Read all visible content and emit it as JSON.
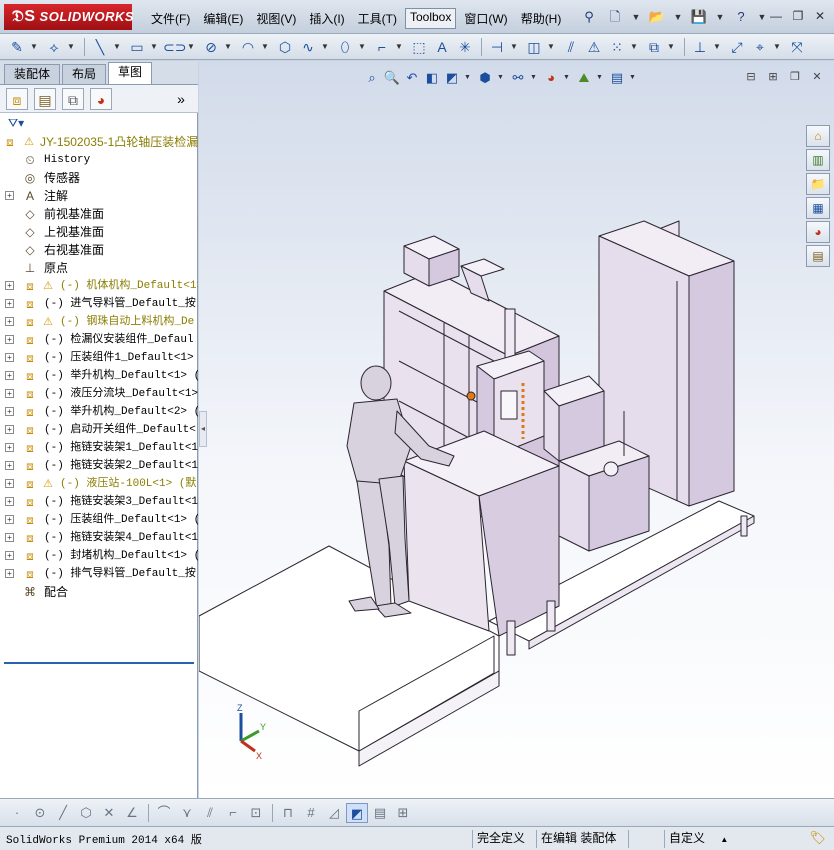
{
  "app": {
    "logo_ds": "𝔇S",
    "logo_text": "SOLIDWORKS"
  },
  "menu": [
    {
      "label": "文件(F)"
    },
    {
      "label": "编辑(E)"
    },
    {
      "label": "视图(V)"
    },
    {
      "label": "插入(I)"
    },
    {
      "label": "工具(T)"
    },
    {
      "label": "Toolbox"
    },
    {
      "label": "窗口(W)"
    },
    {
      "label": "帮助(H)"
    }
  ],
  "tabs": [
    {
      "label": "装配体"
    },
    {
      "label": "布局"
    },
    {
      "label": "草图"
    }
  ],
  "tree": {
    "root": "JY-1502035-1凸轮轴压装检漏",
    "items": [
      {
        "label": "History",
        "icon": "history-icon",
        "glyph": "⏲",
        "mono": true
      },
      {
        "label": "传感器",
        "icon": "sensor-icon",
        "glyph": "◎"
      },
      {
        "label": "注解",
        "icon": "annotation-icon",
        "glyph": "A"
      },
      {
        "label": "前视基准面",
        "icon": "plane-icon",
        "glyph": "◇"
      },
      {
        "label": "上视基准面",
        "icon": "plane-icon",
        "glyph": "◇"
      },
      {
        "label": "右视基准面",
        "icon": "plane-icon",
        "glyph": "◇"
      },
      {
        "label": "原点",
        "icon": "origin-icon",
        "glyph": "⊥"
      },
      {
        "label": "(-) 机体机构_Default<1>",
        "icon": "assembly-icon",
        "warn": true,
        "olive": true
      },
      {
        "label": "(-) 进气导料管_Default_按",
        "icon": "assembly-icon"
      },
      {
        "label": "(-) 钢珠自动上料机构_De",
        "icon": "assembly-icon",
        "warn": true,
        "olive": true
      },
      {
        "label": "(-) 检漏仪安装组件_Defaul",
        "icon": "assembly-icon"
      },
      {
        "label": "(-) 压装组件1_Default<1>",
        "icon": "assembly-icon"
      },
      {
        "label": "(-) 举升机构_Default<1> (",
        "icon": "assembly-icon"
      },
      {
        "label": "(-) 液压分流块_Default<1>",
        "icon": "assembly-icon"
      },
      {
        "label": "(-) 举升机构_Default<2> (",
        "icon": "assembly-icon"
      },
      {
        "label": "(-) 启动开关组件_Default<",
        "icon": "assembly-icon"
      },
      {
        "label": "(-) 拖链安装架1_Default<1",
        "icon": "assembly-icon"
      },
      {
        "label": "(-) 拖链安装架2_Default<1",
        "icon": "assembly-icon"
      },
      {
        "label": "(-) 液压站-100L<1> (默",
        "icon": "assembly-icon",
        "warn": true,
        "olive": true
      },
      {
        "label": "(-) 拖链安装架3_Default<1",
        "icon": "assembly-icon"
      },
      {
        "label": "(-) 压装组件_Default<1> (",
        "icon": "assembly-icon"
      },
      {
        "label": "(-) 拖链安装架4_Default<1",
        "icon": "assembly-icon"
      },
      {
        "label": "(-) 封堵机构_Default<1> (",
        "icon": "assembly-icon"
      },
      {
        "label": "(-) 排气导料管_Default_按",
        "icon": "assembly-icon"
      },
      {
        "label": "配合",
        "icon": "mates-icon",
        "glyph": "⌘"
      }
    ]
  },
  "triad": {
    "x": "X",
    "y": "Y",
    "z": "Z"
  },
  "status": {
    "app_name": "SolidWorks Premium 2014 x64 版",
    "definition": "完全定义",
    "mode": "在编辑 装配体",
    "units": "自定义",
    "units_arrow": "▲"
  },
  "colors": {
    "model_fill": "#ddd3e6",
    "model_stroke": "#2a2530",
    "accent_orange": "#e07a18",
    "selection_blue": "#2b60b5"
  }
}
